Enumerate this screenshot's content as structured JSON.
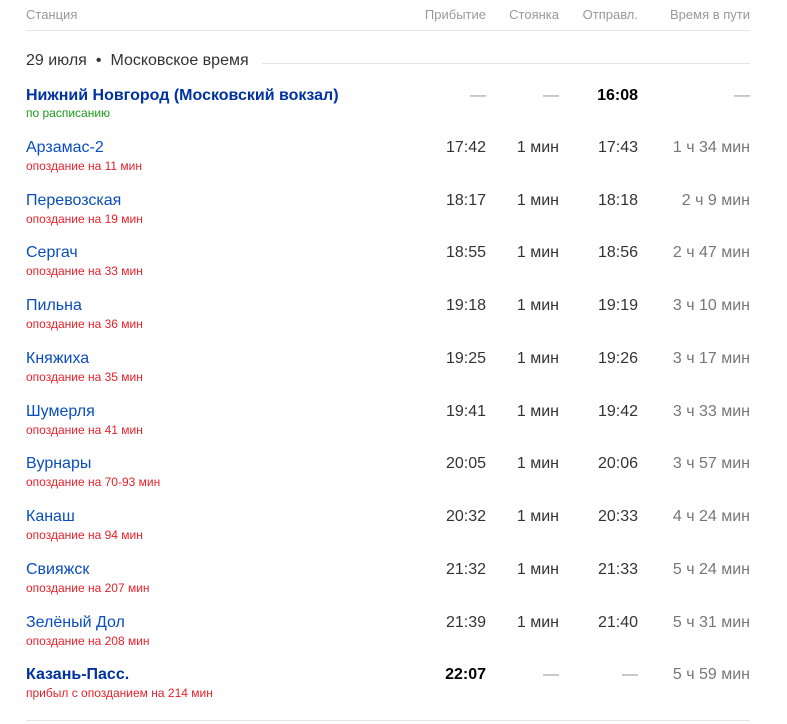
{
  "columns": {
    "station": "Станция",
    "arrival": "Прибытие",
    "stop": "Стоянка",
    "departure": "Отправл.",
    "travel": "Время в пути"
  },
  "date_line": {
    "date": "29 июля",
    "separator": "•",
    "timezone": "Московское время"
  },
  "stations": [
    {
      "name": "Нижний Новгород (Московский вокзал)",
      "status": "по расписанию",
      "status_kind": "ok",
      "arrival": "—",
      "stop": "—",
      "departure": "16:08",
      "travel": "—"
    },
    {
      "name": "Арзамас-2",
      "status": "опоздание на 11 мин",
      "status_kind": "late",
      "arrival": "17:42",
      "stop": "1 мин",
      "departure": "17:43",
      "travel": "1 ч 34 мин"
    },
    {
      "name": "Перевозская",
      "status": "опоздание на 19 мин",
      "status_kind": "late",
      "arrival": "18:17",
      "stop": "1 мин",
      "departure": "18:18",
      "travel": "2 ч 9 мин"
    },
    {
      "name": "Сергач",
      "status": "опоздание на 33 мин",
      "status_kind": "late",
      "arrival": "18:55",
      "stop": "1 мин",
      "departure": "18:56",
      "travel": "2 ч 47 мин"
    },
    {
      "name": "Пильна",
      "status": "опоздание на 36 мин",
      "status_kind": "late",
      "arrival": "19:18",
      "stop": "1 мин",
      "departure": "19:19",
      "travel": "3 ч 10 мин"
    },
    {
      "name": "Княжиха",
      "status": "опоздание на 35 мин",
      "status_kind": "late",
      "arrival": "19:25",
      "stop": "1 мин",
      "departure": "19:26",
      "travel": "3 ч 17 мин"
    },
    {
      "name": "Шумерля",
      "status": "опоздание на 41 мин",
      "status_kind": "late",
      "arrival": "19:41",
      "stop": "1 мин",
      "departure": "19:42",
      "travel": "3 ч 33 мин"
    },
    {
      "name": "Вурнары",
      "status": "опоздание на 70-93 мин",
      "status_kind": "late",
      "arrival": "20:05",
      "stop": "1 мин",
      "departure": "20:06",
      "travel": "3 ч 57 мин"
    },
    {
      "name": "Канаш",
      "status": "опоздание на 94 мин",
      "status_kind": "late",
      "arrival": "20:32",
      "stop": "1 мин",
      "departure": "20:33",
      "travel": "4 ч 24 мин"
    },
    {
      "name": "Свияжск",
      "status": "опоздание на 207 мин",
      "status_kind": "late",
      "arrival": "21:32",
      "stop": "1 мин",
      "departure": "21:33",
      "travel": "5 ч 24 мин"
    },
    {
      "name": "Зелёный Дол",
      "status": "опоздание на 208 мин",
      "status_kind": "late",
      "arrival": "21:39",
      "stop": "1 мин",
      "departure": "21:40",
      "travel": "5 ч 31 мин"
    },
    {
      "name": "Казань-Пасс.",
      "status": "прибыл с опозданием на 214 мин",
      "status_kind": "late",
      "arrival": "22:07",
      "stop": "—",
      "departure": "—",
      "travel": "5 ч 59 мин"
    }
  ],
  "colors": {
    "link": "#0a4dbd",
    "link_bold": "#0033a0",
    "late": "#e5222b",
    "on_time": "#1a9a1a",
    "header_text": "#999999"
  }
}
